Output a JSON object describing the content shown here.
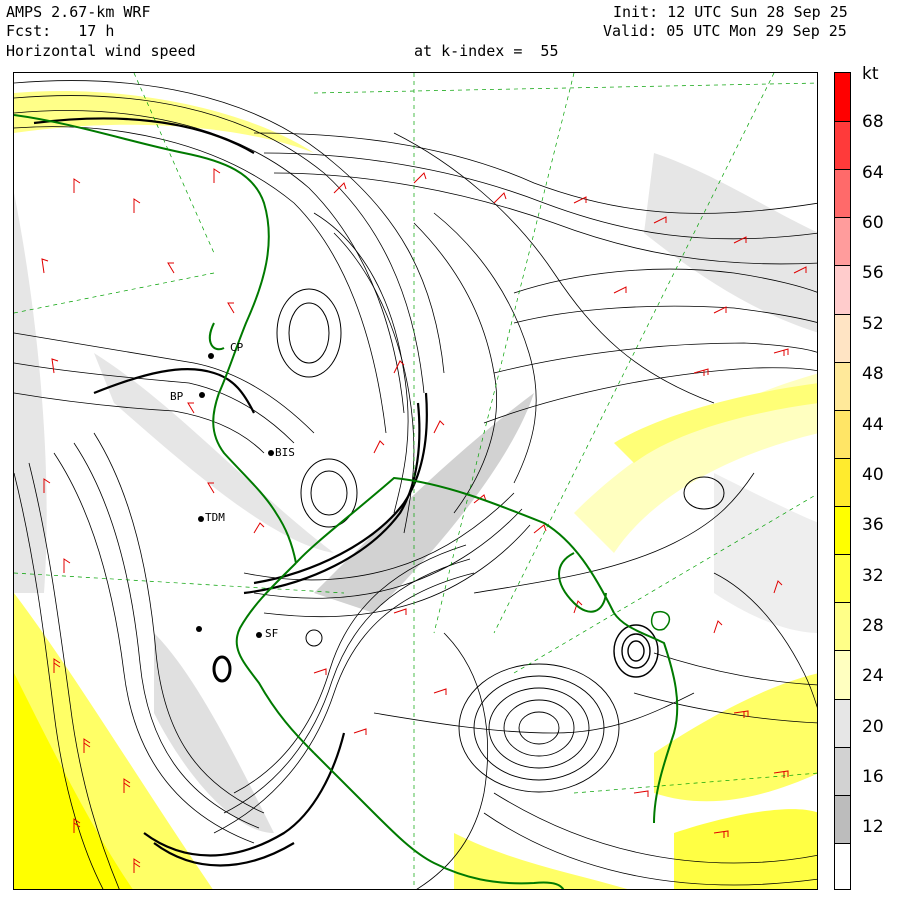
{
  "header": {
    "model": "AMPS 2.67-km WRF",
    "forecast": "Fcst:   17 h",
    "field": "Horizontal wind speed",
    "level": "at k-index =  55",
    "init": "Init: 12 UTC Sun 28 Sep 25",
    "valid": "Valid: 05 UTC Mon 29 Sep 25"
  },
  "colorbar": {
    "unit": "kt",
    "ticks": [
      "68",
      "64",
      "60",
      "56",
      "52",
      "48",
      "44",
      "40",
      "36",
      "32",
      "28",
      "24",
      "20",
      "16",
      "12"
    ],
    "colors": [
      "#ff0000",
      "#ff3a3a",
      "#ff6a6a",
      "#ff9c9c",
      "#ffcccc",
      "#ffe4c4",
      "#ffe99a",
      "#ffe566",
      "#ffeb2e",
      "#ffff00",
      "#ffff44",
      "#ffff88",
      "#ffffc0",
      "#e6e6e6",
      "#d2d2d2",
      "#bcbcbc",
      "#ffffff"
    ]
  },
  "stations": [
    {
      "id": "stn-cp",
      "label": "CP"
    },
    {
      "id": "stn-bp",
      "label": "BP"
    },
    {
      "id": "stn-bis",
      "label": "BIS"
    },
    {
      "id": "stn-tdm",
      "label": "TDM"
    },
    {
      "id": "stn-sf",
      "label": "SF"
    }
  ]
}
